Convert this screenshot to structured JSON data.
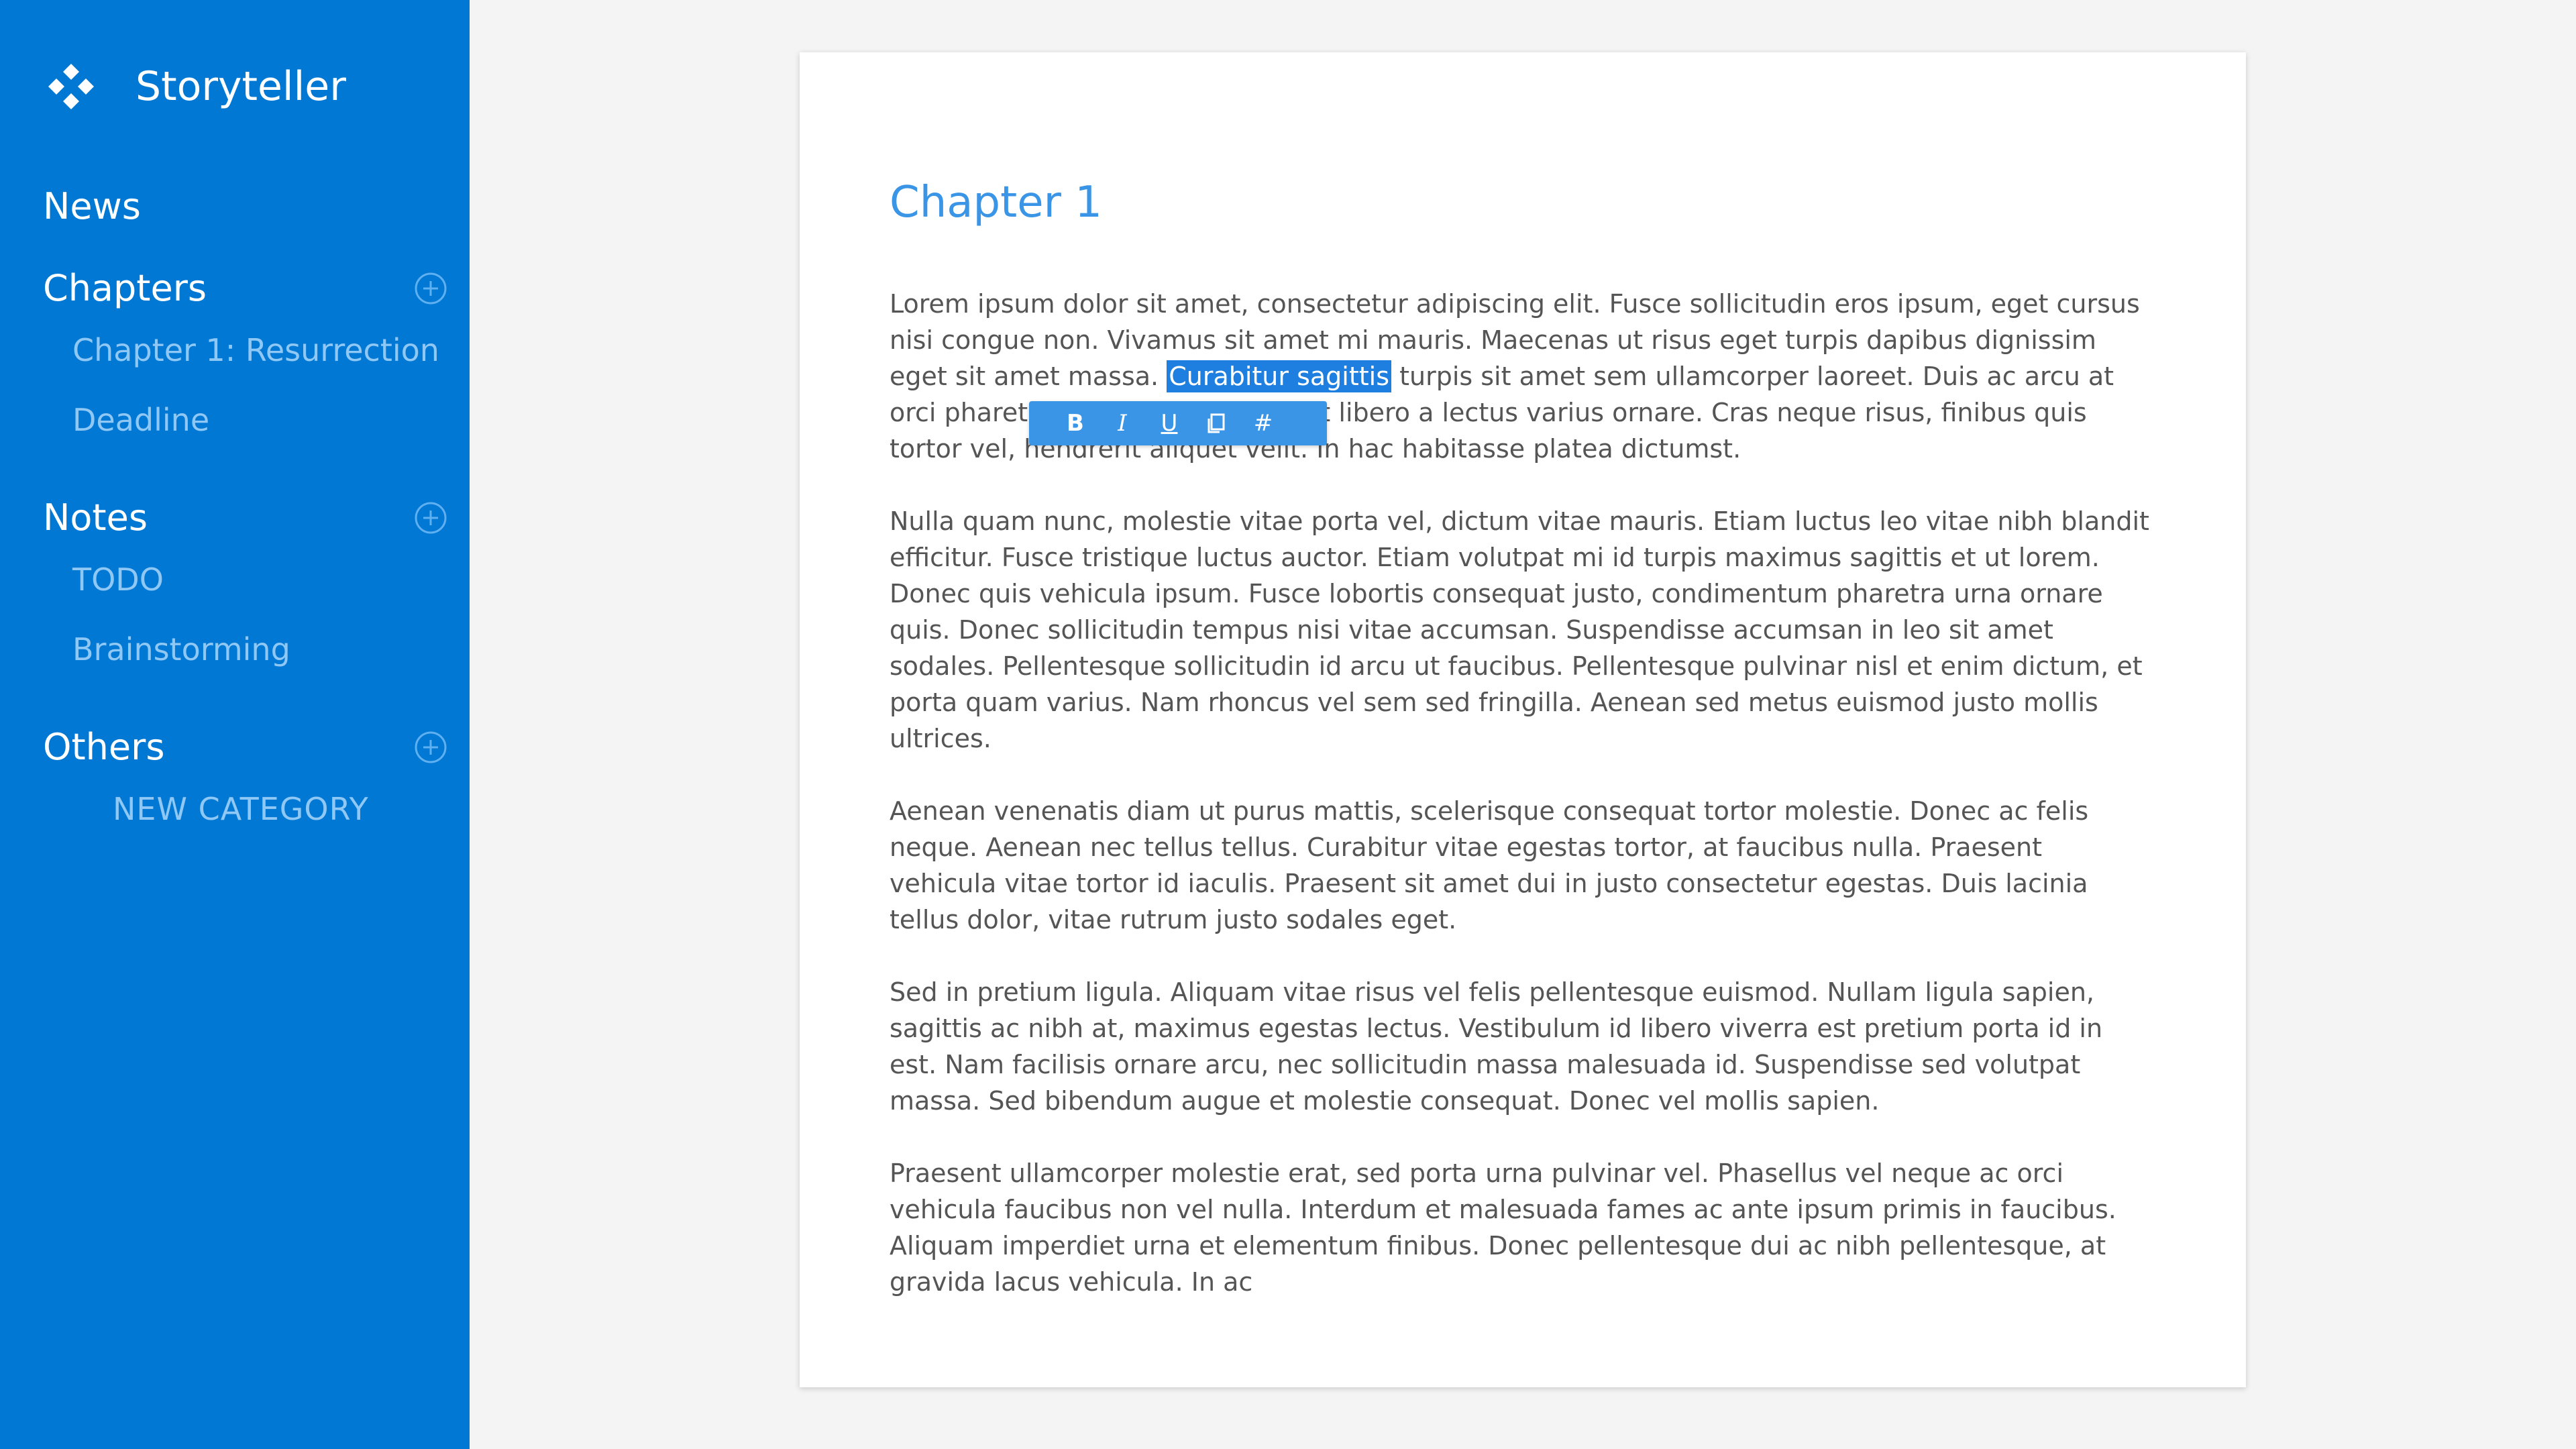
{
  "app": {
    "title": "Storyteller",
    "logo_icon": "diamond-cluster-logo",
    "accent_color": "#0078d4",
    "sub_item_color": "#8fc8f5"
  },
  "sidebar": {
    "news_label": "News",
    "chapters": {
      "label": "Chapters",
      "items": [
        {
          "label": "Chapter 1: Resurrection"
        },
        {
          "label": "Deadline"
        }
      ]
    },
    "notes": {
      "label": "Notes",
      "items": [
        {
          "label": "TODO"
        },
        {
          "label": "Brainstorming"
        }
      ]
    },
    "others": {
      "label": "Others",
      "new_category_label": "NEW CATEGORY"
    },
    "add_icon": "plus-circle-icon"
  },
  "document": {
    "title": "Chapter 1",
    "title_color": "#3a95e6",
    "selection": "Curabitur sagittis",
    "paragraphs": [
      {
        "before": "Lorem ipsum dolor sit amet, consectetur adipiscing elit. Fusce sollicitudin eros ipsum, eget cursus nisi congue non. Vivamus sit amet mi mauris. Maecenas ut risus eget turpis dapibus dignissim eget sit amet massa. ",
        "after": " turpis sit amet sem ullamcorper laoreet. Duis ac arcu at orci pharetra tempor. Maecenas et libero a lectus varius ornare. Cras neque risus, finibus quis tortor vel, hendrerit aliquet velit. In hac habitasse platea dictumst."
      },
      {
        "text": "Nulla quam nunc, molestie vitae porta vel, dictum vitae mauris. Etiam luctus leo vitae nibh blandit efficitur. Fusce tristique luctus auctor. Etiam volutpat mi id turpis maximus sagittis et ut lorem. Donec quis vehicula ipsum. Fusce lobortis consequat justo, condimentum pharetra urna ornare quis. Donec sollicitudin tempus nisi vitae accumsan. Suspendisse accumsan in leo sit amet sodales. Pellentesque sollicitudin id arcu ut faucibus. Pellentesque pulvinar nisl et enim dictum, et porta quam varius. Nam rhoncus vel sem sed fringilla. Aenean sed metus euismod justo mollis ultrices."
      },
      {
        "text": "Aenean venenatis diam ut purus mattis, scelerisque consequat tortor molestie. Donec ac felis neque. Aenean nec tellus tellus. Curabitur vitae egestas tortor, at faucibus nulla. Praesent vehicula vitae tortor id iaculis. Praesent sit amet dui in justo consectetur egestas. Duis lacinia tellus dolor, vitae rutrum justo sodales eget."
      },
      {
        "text": "Sed in pretium ligula. Aliquam vitae risus vel felis pellentesque euismod. Nullam ligula sapien, sagittis ac nibh at, maximus egestas lectus. Vestibulum id libero viverra est pretium porta id in est. Nam facilisis ornare arcu, nec sollicitudin massa malesuada id. Suspendisse sed volutpat massa. Sed bibendum augue et molestie consequat. Donec vel mollis sapien."
      },
      {
        "text": "Praesent ullamcorper molestie erat, sed porta urna pulvinar vel. Phasellus vel neque ac orci vehicula faucibus non vel nulla. Interdum et malesuada fames ac ante ipsum primis in faucibus. Aliquam imperdiet urna et elementum finibus. Donec pellentesque dui ac nibh pellentesque, at gravida lacus vehicula. In ac"
      }
    ]
  },
  "format_toolbar": {
    "bold_label": "B",
    "italic_label": "I",
    "underline_label": "U",
    "copy_icon": "copy-icon",
    "hash_label": "#",
    "background_color": "#3a95e6"
  }
}
